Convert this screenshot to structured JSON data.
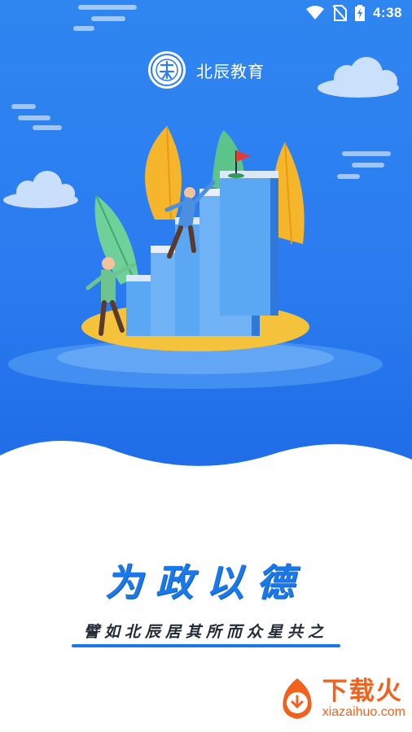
{
  "status_bar": {
    "time": "4:38",
    "icons": [
      "wifi-icon",
      "no-sim-icon",
      "battery-charging-icon"
    ]
  },
  "brand": {
    "name": "北辰教育",
    "logo": "beichen-emblem-logo"
  },
  "slogan": {
    "title": "为政以德",
    "subtitle": "譬如北辰居其所而众星共之"
  },
  "watermark": {
    "title": "下载火",
    "url": "xiazaihuo.com",
    "icon": "flame-download-icon"
  },
  "colors": {
    "hero_blue": "#2b7cf0",
    "slogan_blue": "#1a78e8",
    "watermark_orange": "#f0621e",
    "island_yellow": "#f5c23b",
    "book_blue": "#6fb2f5"
  }
}
